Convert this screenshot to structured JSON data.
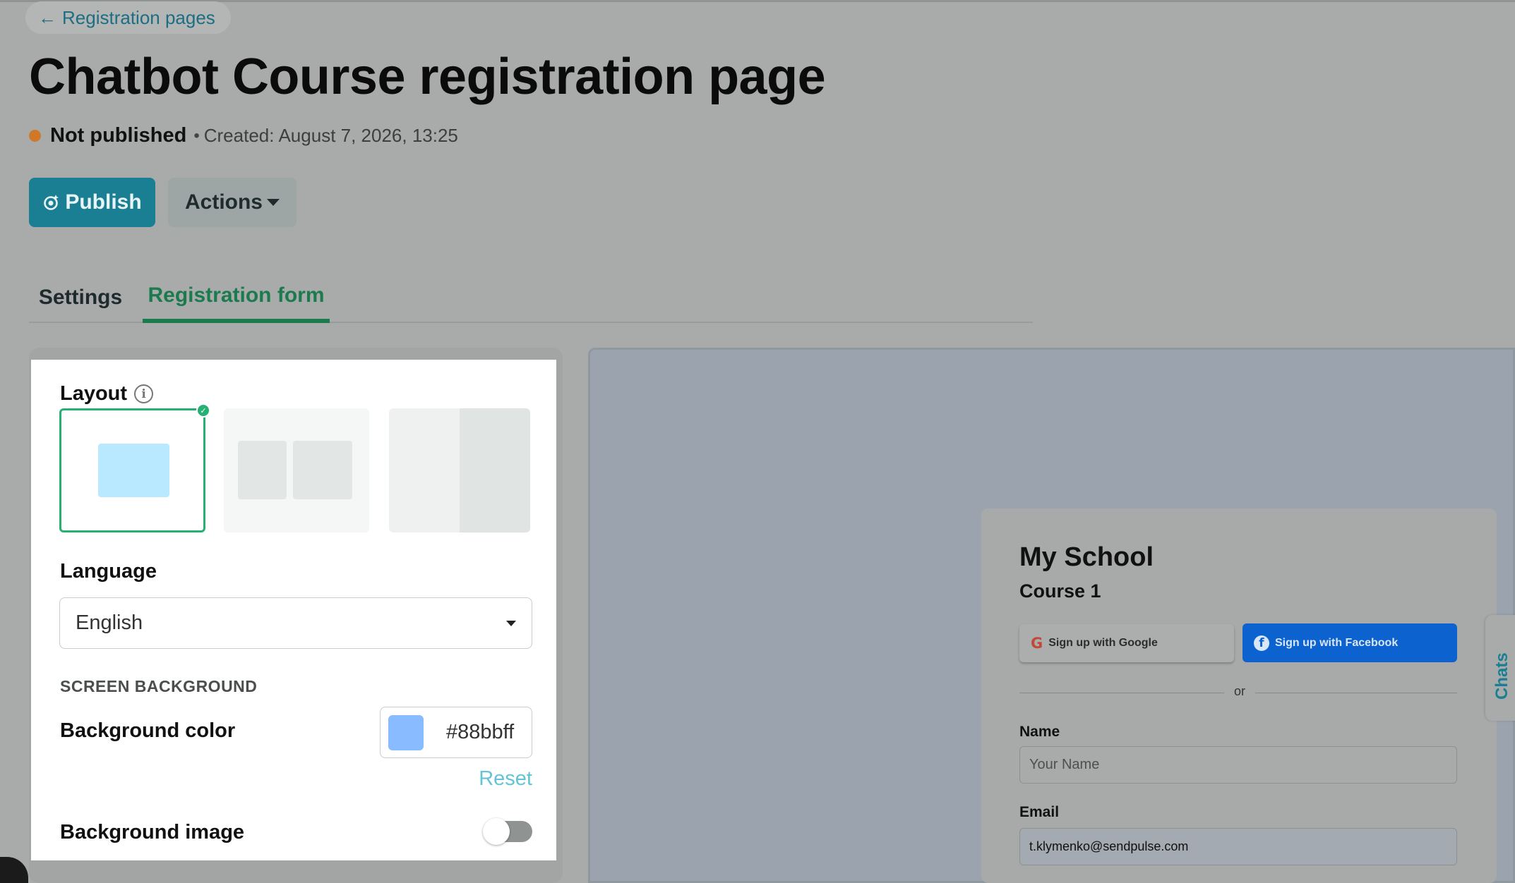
{
  "back_link": {
    "label": "Registration pages",
    "icon": "arrow-left-icon"
  },
  "page": {
    "title": "Chatbot Course registration page",
    "status": "Not published",
    "status_color": "#d0782a",
    "separator": "•",
    "created_label": "Created:",
    "created_value": "August 7, 2026, 13:25"
  },
  "toolbar": {
    "publish_label": "Publish",
    "publish_icon": "broadcast-icon",
    "actions_label": "Actions"
  },
  "tabs": [
    {
      "label": "Settings",
      "active": false
    },
    {
      "label": "Registration form",
      "active": true
    }
  ],
  "settings": {
    "layout_label": "Layout",
    "layout_selected": 1,
    "language_label": "Language",
    "language_value": "English",
    "section_title": "SCREEN BACKGROUND",
    "bg_color_label": "Background color",
    "bg_color_value": "#88bbff",
    "reset_label": "Reset",
    "bg_image_label": "Background image",
    "bg_image_enabled": false
  },
  "preview": {
    "school": "My School",
    "course": "Course 1",
    "google_btn": "Sign up with Google",
    "facebook_btn": "Sign up with Facebook",
    "or_text": "or",
    "name_label": "Name",
    "name_placeholder": "Your Name",
    "email_label": "Email",
    "email_value": "t.klymenko@sendpulse.com"
  },
  "chats_tab": {
    "label": "Chats"
  },
  "colors": {
    "accent": "#1a7f93",
    "active_tab": "#1b7b4e",
    "facebook": "#0c63cf"
  }
}
